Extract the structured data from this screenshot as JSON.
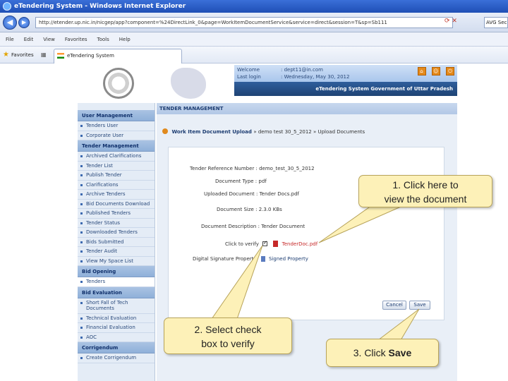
{
  "browser": {
    "title": "eTendering System - Windows Internet Explorer",
    "url": "http://etender.up.nic.in/nicgep/app?component=%24DirectLink_0&page=WorkItemDocumentService&service=direct&session=T&sp=Sb111",
    "search_text": "AVG Secure",
    "menu": [
      "File",
      "Edit",
      "View",
      "Favorites",
      "Tools",
      "Help"
    ],
    "favorites_label": "Favorites",
    "tab_label": "eTendering System"
  },
  "header": {
    "welcome_label": "Welcome",
    "welcome_value": ": dept11@in.com",
    "last_login_label": "Last login",
    "last_login_value": ": Wednesday, May 30, 2012",
    "portal_title": "eTendering System Government of Uttar Pradesh"
  },
  "sidebar": {
    "sections": [
      {
        "title": "User Management",
        "items": [
          "Tenders User",
          "Corporate User"
        ]
      },
      {
        "title": "Tender Management",
        "items": [
          "Archived Clarifications",
          "Tender List",
          "Publish Tender",
          "Clarifications",
          "Archive Tenders",
          "Bid Documents Download",
          "Published Tenders",
          "Tender Status",
          "Downloaded Tenders",
          "Bids Submitted",
          "Tender Audit",
          "View My Space List"
        ]
      },
      {
        "title": "Bid Opening",
        "items": [
          "Tenders"
        ]
      },
      {
        "title": "Bid Evaluation",
        "items": [
          "Short Fall of Tech Documents",
          "Technical Evaluation",
          "Financial Evaluation",
          "AOC"
        ]
      },
      {
        "title": "Corrigendum",
        "items": [
          "Create Corrigendum"
        ]
      }
    ]
  },
  "main": {
    "section_title": "TENDER MANAGEMENT",
    "breadcrumb_title": "Work Item Document Upload",
    "breadcrumb_rest": "» demo test 30_5_2012 » Upload Documents",
    "form": {
      "ref_label": "Tender Reference Number :",
      "ref_value": "demo_test_30_5_2012",
      "type_label": "Document Type :",
      "type_value": "pdf",
      "uploaded_label": "Uploaded Document :",
      "uploaded_value": "Tender Docs.pdf",
      "size_label": "Document Size :",
      "size_value": "2.3.0 KBs",
      "desc_label": "Document Description :",
      "desc_value": "Tender Document",
      "verify_label": "Click to verify",
      "verify_check": "✓",
      "doc_link": "TenderDoc.pdf",
      "sig_label": "Digital Signature Property",
      "sig_link": "Signed Property"
    },
    "buttons": {
      "cancel": "Cancel",
      "save": "Save"
    }
  },
  "callouts": {
    "c1_line1": "1. Click here to",
    "c1_line2": "view the document",
    "c2_line1": "2. Select check",
    "c2_line2": "box to verify",
    "c3_prefix": "3. Click ",
    "c3_bold": "Save"
  }
}
